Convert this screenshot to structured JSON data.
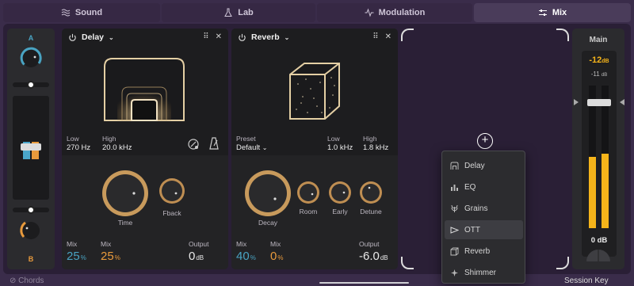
{
  "tabs": [
    {
      "label": "Sound",
      "icon": "waves-icon"
    },
    {
      "label": "Lab",
      "icon": "flask-icon"
    },
    {
      "label": "Modulation",
      "icon": "pulse-icon"
    },
    {
      "label": "Mix",
      "icon": "sliders-icon",
      "active": true
    }
  ],
  "ab": {
    "a_label": "A",
    "b_label": "B"
  },
  "delay": {
    "name": "Delay",
    "low_label": "Low",
    "low_value": "270 Hz",
    "high_label": "High",
    "high_value": "20.0 kHz",
    "knob_time": "Time",
    "knob_fback": "Fback",
    "mix1_label": "Mix",
    "mix1_value": "25",
    "mix1_unit": "%",
    "mix2_label": "Mix",
    "mix2_value": "25",
    "mix2_unit": "%",
    "output_label": "Output",
    "output_value": "0",
    "output_unit": "dB"
  },
  "reverb": {
    "name": "Reverb",
    "preset_label": "Preset",
    "preset_value": "Default",
    "low_label": "Low",
    "low_value": "1.0 kHz",
    "high_label": "High",
    "high_value": "1.8 kHz",
    "knob_decay": "Decay",
    "knob_room": "Room",
    "knob_early": "Early",
    "knob_detune": "Detune",
    "mix1_label": "Mix",
    "mix1_value": "40",
    "mix1_unit": "%",
    "mix2_label": "Mix",
    "mix2_value": "0",
    "mix2_unit": "%",
    "output_label": "Output",
    "output_value": "-6.0",
    "output_unit": "dB"
  },
  "menu": {
    "items": [
      "Delay",
      "EQ",
      "Grains",
      "OTT",
      "Reverb",
      "Shimmer"
    ],
    "selected": "OTT"
  },
  "main": {
    "title": "Main",
    "peak_value": "-12",
    "peak_unit": "dB",
    "rms_value": "-11",
    "rms_unit": "dB",
    "gain": "0 dB",
    "level_left": 0.5,
    "level_right": 0.52
  },
  "footer": {
    "left": "Chords",
    "right": "Session Key"
  },
  "colors": {
    "accent_a": "#49a3c2",
    "accent_b": "#e89a3c",
    "meter": "#f5b41a"
  }
}
